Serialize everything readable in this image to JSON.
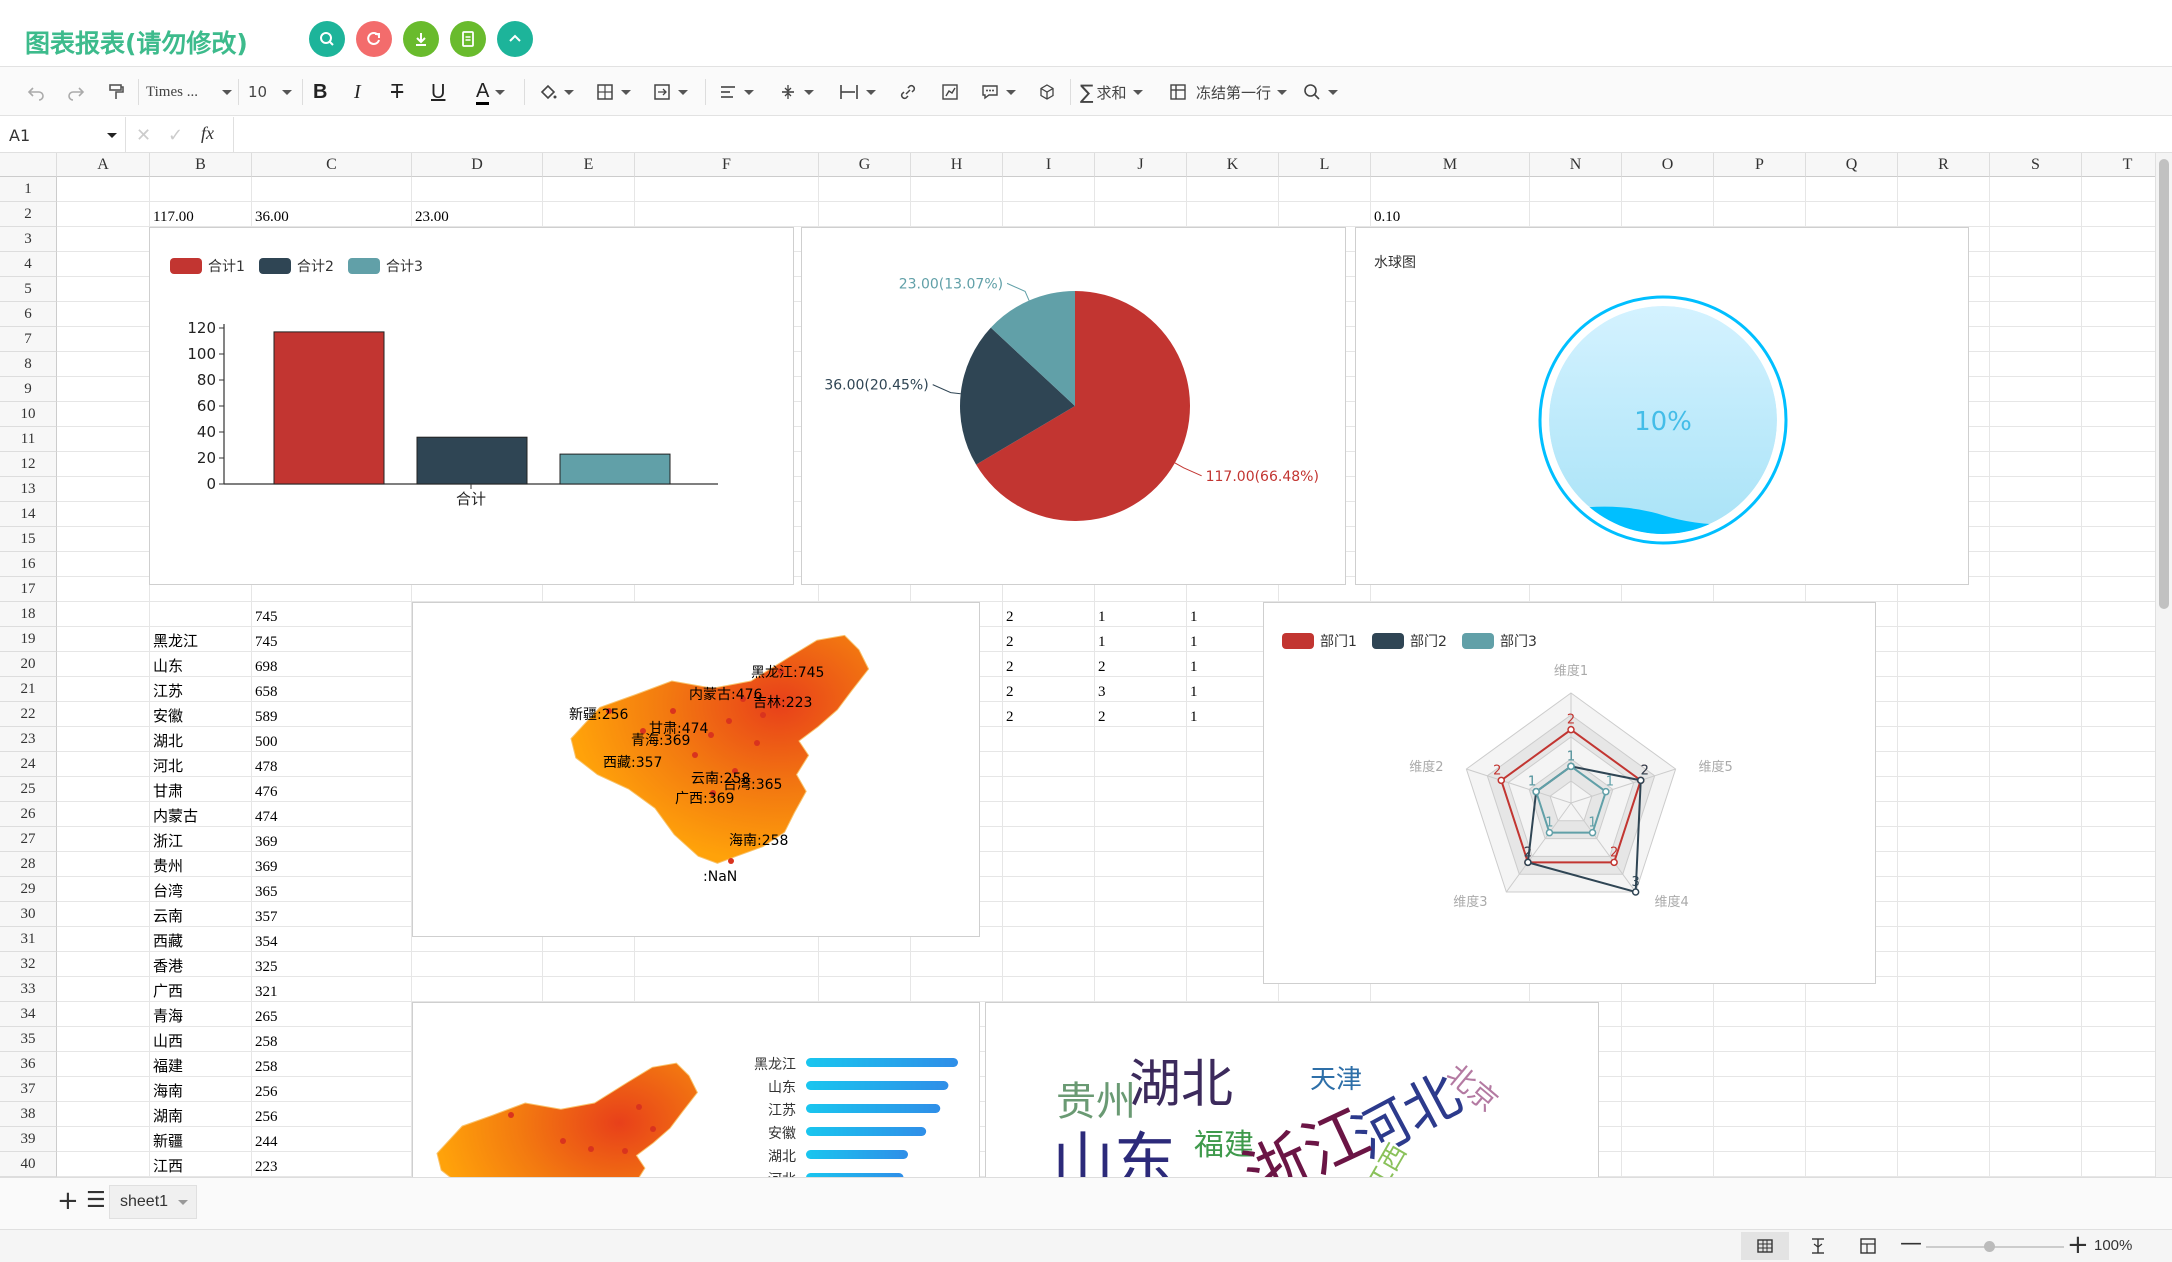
{
  "app": {
    "title": "图表报表(请勿修改)"
  },
  "colors": {
    "red": "#c23531",
    "navy": "#2f4554",
    "teal": "#61a0a8",
    "green_title": "#3dbb8c",
    "liquid": "#00bfff"
  },
  "title_buttons": [
    {
      "icon": "search-icon",
      "color": "#1db49a"
    },
    {
      "icon": "refresh-icon",
      "color": "#f36c6c"
    },
    {
      "icon": "download-icon",
      "color": "#69bb2d"
    },
    {
      "icon": "document-icon",
      "color": "#69bb2d"
    },
    {
      "icon": "chevron-up-icon",
      "color": "#1db49a"
    }
  ],
  "toolbar": {
    "font": "Times ...",
    "size": "10",
    "sum_label": "求和",
    "freeze_label": "冻结第一行"
  },
  "formula_bar": {
    "cell_ref": "A1",
    "fx": "fx"
  },
  "columns": [
    "A",
    "B",
    "C",
    "D",
    "E",
    "F",
    "G",
    "H",
    "I",
    "J",
    "K",
    "L",
    "M",
    "N",
    "O",
    "P",
    "Q",
    "R",
    "S",
    "T"
  ],
  "rows": [
    "1",
    "2",
    "3",
    "4",
    "5",
    "6",
    "7",
    "8",
    "9",
    "10",
    "11",
    "12",
    "13",
    "14",
    "15",
    "16",
    "17",
    "18",
    "19",
    "20",
    "21",
    "22",
    "23",
    "24",
    "25",
    "26",
    "27",
    "28",
    "29",
    "30",
    "31",
    "32",
    "33",
    "34",
    "35",
    "36",
    "37",
    "38",
    "39",
    "40"
  ],
  "cells": {
    "row2": {
      "b": "117.00",
      "c": "36.00",
      "d": "23.00",
      "m": "0.10"
    },
    "c18": "745",
    "provinces": [
      {
        "name": "黑龙江",
        "value": "745"
      },
      {
        "name": "山东",
        "value": "698"
      },
      {
        "name": "江苏",
        "value": "658"
      },
      {
        "name": "安徽",
        "value": "589"
      },
      {
        "name": "湖北",
        "value": "500"
      },
      {
        "name": "河北",
        "value": "478"
      },
      {
        "name": "甘肃",
        "value": "476"
      },
      {
        "name": "内蒙古",
        "value": "474"
      },
      {
        "name": "浙江",
        "value": "369"
      },
      {
        "name": "贵州",
        "value": "369"
      },
      {
        "name": "台湾",
        "value": "365"
      },
      {
        "name": "云南",
        "value": "357"
      },
      {
        "name": "西藏",
        "value": "354"
      },
      {
        "name": "香港",
        "value": "325"
      },
      {
        "name": "广西",
        "value": "321"
      },
      {
        "name": "青海",
        "value": "265"
      },
      {
        "name": "山西",
        "value": "258"
      },
      {
        "name": "福建",
        "value": "258"
      },
      {
        "name": "海南",
        "value": "256"
      },
      {
        "name": "湖南",
        "value": "256"
      },
      {
        "name": "新疆",
        "value": "244"
      },
      {
        "name": "江西",
        "value": "223"
      }
    ],
    "ijk": [
      [
        "2",
        "1",
        "1"
      ],
      [
        "2",
        "1",
        "1"
      ],
      [
        "2",
        "2",
        "1"
      ],
      [
        "2",
        "3",
        "1"
      ],
      [
        "2",
        "2",
        "1"
      ]
    ]
  },
  "chart_data": [
    {
      "type": "bar",
      "categories": [
        "合计"
      ],
      "series": [
        {
          "name": "合计1",
          "values": [
            117
          ]
        },
        {
          "name": "合计2",
          "values": [
            36
          ]
        },
        {
          "name": "合计3",
          "values": [
            23
          ]
        }
      ],
      "ylim": [
        0,
        120
      ],
      "yticks": [
        "0",
        "20",
        "40",
        "60",
        "80",
        "100",
        "120"
      ]
    },
    {
      "type": "pie",
      "slices": [
        {
          "value": 117,
          "label": "117.00(66.48%)"
        },
        {
          "value": 36,
          "label": "36.00(20.45%)"
        },
        {
          "value": 23,
          "label": "23.00(13.07%)"
        }
      ]
    },
    {
      "type": "liquidfill",
      "title": "水球图",
      "value": 0.1,
      "label": "10%"
    },
    {
      "type": "map",
      "labels": [
        "黑龙江:745",
        "内蒙古:476",
        "吉林:223",
        "新疆:256",
        "甘肃:474",
        "青海:369",
        "西藏:357",
        "云南:258",
        "广西:369",
        "台湾:365",
        "海南:258",
        ":NaN"
      ]
    },
    {
      "type": "radar",
      "series": [
        {
          "name": "部门1",
          "values": [
            2,
            2,
            2,
            2,
            2
          ]
        },
        {
          "name": "部门2",
          "values": [
            1,
            2,
            3,
            2,
            1
          ]
        },
        {
          "name": "部门3",
          "values": [
            1,
            1,
            1,
            1,
            1
          ]
        }
      ],
      "indicators": [
        "维度1",
        "维度5",
        "维度4",
        "维度3",
        "维度2"
      ]
    },
    {
      "type": "bar-horizontal",
      "categories": [
        "黑龙江",
        "山东",
        "江苏",
        "安徽",
        "湖北",
        "河北"
      ],
      "values": [
        745,
        698,
        658,
        589,
        500,
        478
      ]
    },
    {
      "type": "wordcloud",
      "words": [
        "湖北",
        "贵州",
        "天津",
        "河北",
        "北京",
        "福建",
        "浙江",
        "山东",
        "江西"
      ]
    }
  ],
  "sheet": {
    "name": "sheet1"
  },
  "status": {
    "zoom": "100%"
  }
}
